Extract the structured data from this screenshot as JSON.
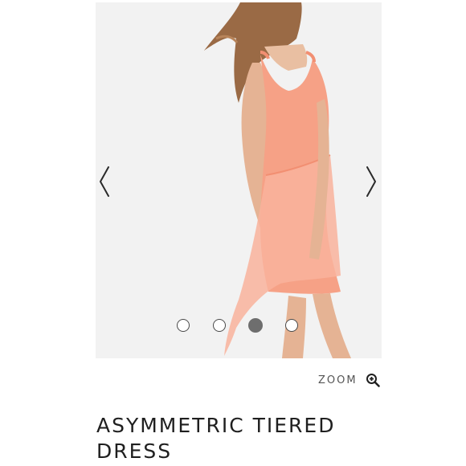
{
  "gallery": {
    "image_alt": "Model wearing asymmetric tiered coral dress",
    "prev_icon": "chevron-left-icon",
    "next_icon": "chevron-right-icon",
    "slide_count": 4,
    "active_slide": 3
  },
  "zoom": {
    "label": "ZOOM",
    "icon": "zoom-in-icon"
  },
  "product": {
    "title": "ASYMMETRIC TIERED DRESS"
  },
  "colors": {
    "dress": "#f7a58a",
    "background": "#f1f1f1",
    "text": "#1f1f1f",
    "dot_active": "#6e6e6e"
  }
}
